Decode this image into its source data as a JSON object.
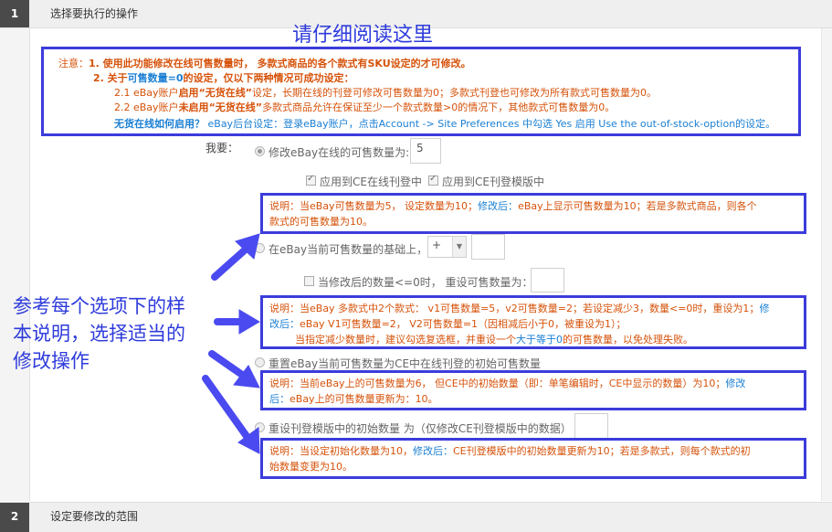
{
  "sections": [
    {
      "num": "1",
      "title": "选择要执行的操作"
    },
    {
      "num": "2",
      "title": "设定要修改的范围"
    }
  ],
  "overlay": {
    "top_hint": "请仔细阅读这里",
    "side_hint_l1": "参考每个选项下的样",
    "side_hint_l2": "本说明，选择适当的",
    "side_hint_l3": "修改操作",
    "arrow_color": "#4a4af0"
  },
  "notice": {
    "prefix": "注意：",
    "line1": "1. 使用此功能修改在线可售数量时， 多款式商品的各个款式有SKU设定的才可修改。",
    "line2_a": "2. 关于",
    "line2_b": "可售数量=0",
    "line2_c": "的设定，仅以下两种情况可成功设定：",
    "line3_a": "2.1 eBay账户",
    "line3_b": "启用",
    "line3_c": "“无货在线”",
    "line3_d": "设定，长期在线的刊登可修改可售数量为0；多款式刊登也可修改为所有款式可售数量为0。",
    "line4_a": "2.2 eBay账户",
    "line4_b": "未启用",
    "line4_c": "“无货在线”",
    "line4_d": "多款式商品允许在保证至少一个款式数量>0的情况下，其他款式可售数量为0。",
    "line5_a": "无货在线如何启用？",
    "line5_b": "eBay后台设定：登录eBay账户，点击Account -> Site Preferences 中勾选 Yes 启用 Use the out-of-stock-option的设定。"
  },
  "form": {
    "want_label": "我要：",
    "opt1_label": "修改eBay在线的可售数量为:",
    "opt1_value": "5",
    "chk_ce_online": "应用到CE在线刊登中",
    "chk_ce_template": "应用到CE刊登模版中",
    "expl1_a": "说明：当eBay可售数量为5， 设定数量为10；",
    "expl1_b": "修改后：",
    "expl1_c": "eBay上显示可售数量为10；若是多款式商品，则各个",
    "expl1_d": "款式的可售数量为10。",
    "opt2_label": "在eBay当前可售数量的基础上，",
    "opt2_op": "+",
    "opt2_value": "",
    "chk_reset_label": "当修改后的数量<=0时， 重设可售数量为：",
    "chk_reset_value": "",
    "expl2_a": "说明：当eBay 多款式中2个款式： v1可售数量=5，v2可售数量=2；若设定减少3，数量<=0时，重设为1；",
    "expl2_b": "修",
    "expl2_c": "改后：",
    "expl2_d": "eBay V1可售数量=2， V2可售数量=1（因相减后小于0，被重设为1）；",
    "expl2_e": "当指定减少数量时，建议勾选复选框，并重设一个",
    "expl2_f": "大于等于0",
    "expl2_g": "的可售数量，以免处理失败。",
    "opt3_label": "重置eBay当前可售数量为CE中在线刊登的初始可售数量",
    "expl3_a": "说明：当前eBay上的可售数量为6， 但CE中的初始数量（即：单笔编辑时，CE中显示的数量）为10；",
    "expl3_b": "修改",
    "expl3_c": "后：",
    "expl3_d": "eBay上的可售数量更新为：10。",
    "opt4_label": "重设刊登模版中的初始数量 为（仅修改CE刊登模版中的数据）",
    "opt4_value": "",
    "expl4_a": "说明：当设定初始化数量为10，",
    "expl4_b": "修改后：",
    "expl4_c": "CE刊登模版中的初始数量更新为10；若是多款式，则每个款式的初",
    "expl4_d": "始数量变更为10。"
  }
}
